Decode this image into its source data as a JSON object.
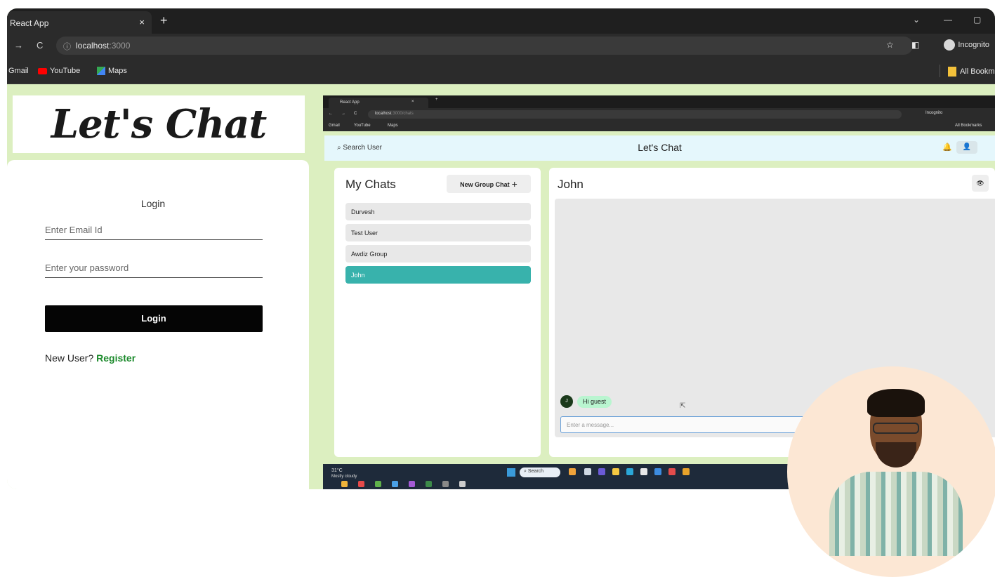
{
  "browser": {
    "tab_title": "React App",
    "tab_close": "×",
    "new_tab": "+",
    "url_host": "localhost",
    "url_port": ":3000",
    "incognito_label": "Incognito",
    "bookmarks": [
      "Gmail",
      "YouTube",
      "Maps"
    ],
    "all_bookmarks": "All Bookm"
  },
  "login_app": {
    "logo": "Let's Chat",
    "title": "Login",
    "email_placeholder": "Enter Email Id",
    "password_placeholder": "Enter your password",
    "login_button": "Login",
    "new_user_text": "New User?",
    "register_link": "Register"
  },
  "inner_browser": {
    "tab_title": "React App",
    "url_host": "localhost",
    "url_path": ":3000/chats",
    "incognito_label": "Incognito",
    "bookmarks": [
      "Gmail",
      "YouTube",
      "Maps"
    ],
    "all_bookmarks": "All Bookmarks"
  },
  "chat_app": {
    "search_label": "Search User",
    "header_title": "Let's Chat",
    "my_chats_title": "My Chats",
    "new_group_button": "New Group Chat",
    "chats": [
      "Durvesh",
      "Test User",
      "Awdiz Group",
      "John"
    ],
    "active_chat": "John",
    "chat_header_name": "John",
    "message_avatar_initial": "J",
    "message_text": "Hi guest",
    "message_placeholder": "Enter a message..."
  },
  "taskbar": {
    "temperature": "31°C",
    "weather": "Mostly cloudy",
    "search": "Search"
  },
  "colors": {
    "page_bg": "#dcefc0",
    "active_chat": "#38b2ac",
    "register_link": "#1c8a2c",
    "message_bubble": "#b9f5d0",
    "chat_header_bg": "#e5f7fc"
  }
}
